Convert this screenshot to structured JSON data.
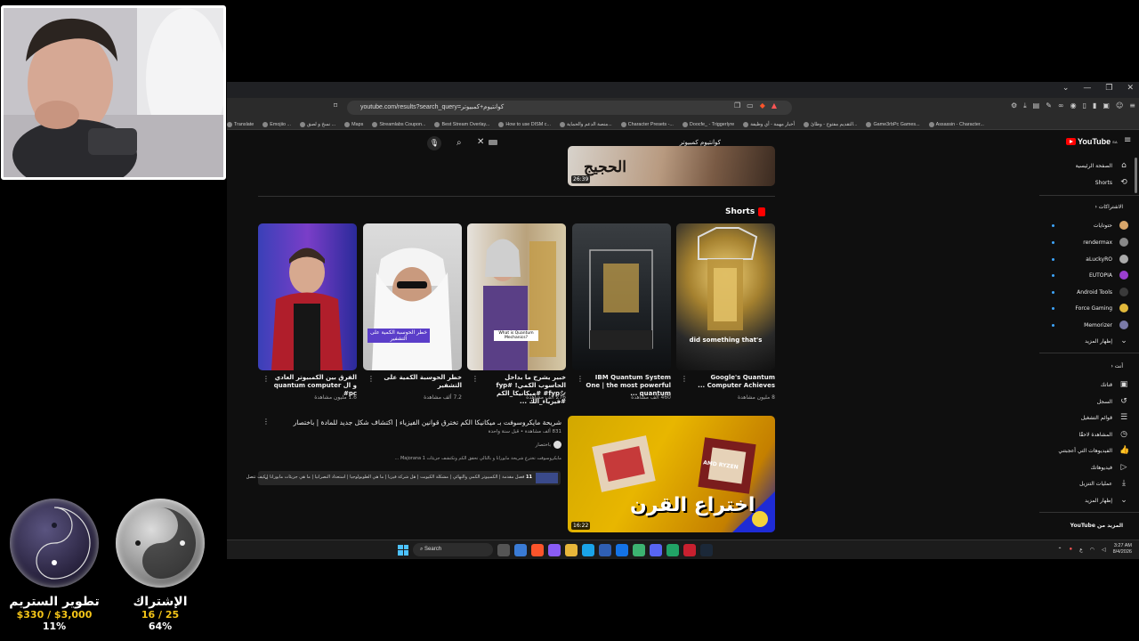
{
  "browser": {
    "url": "youtube.com/results?search_query=كوانتيوم+كمبيوتر",
    "bookmarks": [
      "Translate",
      "Emojiio ...",
      "نسخ و لصق ...",
      "Maps",
      "Streamlabs Coupon...",
      "Best Stream Overlay...",
      "How to use DISM c...",
      "منصة الدعم والحماية...",
      "Character Presets -...",
      "Doocfe_ - Triggerlyre",
      "أخبار مهمة - أي وظيفة",
      "التقديم مفتوح - وظائ...",
      "Game3rbPc Games...",
      "Assassin - Character..."
    ]
  },
  "search": {
    "query": "كوانتيوم كمبيوتر"
  },
  "top_video": {
    "title_art": "الحجيج",
    "duration": "26:39"
  },
  "shorts": {
    "heading": "Shorts",
    "items": [
      {
        "title": "Google's Quantum Computer Achieves ...",
        "views": "8 مليون مشاهدة",
        "caption": "did something that's"
      },
      {
        "title": "IBM Quantum System One | the most powerful quantum ...",
        "views": "460 ألف مشاهدة",
        "caption": ""
      },
      {
        "title": "خبير يشرح ما بداخل الحاسوب الكمي! #fyp #fypシ #ميكانيكا_الكم #فيزياء_الك ...",
        "views": "276 ألف مشاهدة",
        "caption": "What is Quantum Mechanics?"
      },
      {
        "title": "خطر الحوسبة الكمية على التشفير",
        "views": "7.2 ألف مشاهدة",
        "caption": "خطر الحوسبة الكمية على التشفير"
      },
      {
        "title": "الفرق بين الكمبيوتر العادي و ال quantum computer #pc",
        "views": "1.6 مليون مشاهدة",
        "caption": ""
      }
    ]
  },
  "video2": {
    "title": "شريحة مايكروسوفت بـ ميكانيكا الكم تخترق قوانين الفيزياء | اكتشاف شكل جديد للمادة | باختصار",
    "meta": "831 ألف مشاهدة • قبل سنة واحدة",
    "channel": "باختصار",
    "desc": "مايكروسوفت تخترع شريحة مايورانا و بالتالي تحقق الكم وتكتشف جزيئات Majorana 1 ...",
    "chapters_count": "11",
    "chapters_text": "فصل مقدمة | الكمبيوتر الكمي والنهائي | مشكلة الكيوبت | هل شركة فيزيا | ما هي الطوبولوجيا | استعداد النصرانيا | ما هي جزيئات مايورانا | كيف تتصل",
    "thumb_text": "اختراع القرن",
    "duration": "16:22",
    "chip_brand": "AMD RYZEN"
  },
  "sidebar": {
    "logo": "YouTube",
    "logo_region": "SA",
    "home": "الصفحة الرئيسية",
    "shorts": "Shorts",
    "subs_header": "الاشتراكات",
    "subs": [
      {
        "name": "حتوتايات",
        "color": "#d9a66a"
      },
      {
        "name": "rendermax",
        "color": "#888888"
      },
      {
        "name": "aLuckyRO",
        "color": "#aaaaaa"
      },
      {
        "name": "EUTOPIA",
        "color": "#9b3fd1"
      },
      {
        "name": "Android Tools",
        "color": "#3a3a3a"
      },
      {
        "name": "Force Gaming",
        "color": "#e2b93b"
      },
      {
        "name": "Memorizer",
        "color": "#7a7aa8"
      }
    ],
    "show_more": "إظهار المزيد",
    "you_header": "أنت",
    "you_items": [
      "قناتك",
      "السجل",
      "قوائم التشغيل",
      "المشاهدة لاحقًا",
      "الفيديوهات التي أعجبتني",
      "فيديوهاتك",
      "عمليات التنزيل",
      "إظهار المزيد"
    ],
    "more_from": "المزيد من YouTube"
  },
  "taskbar": {
    "search": "Search",
    "time": "3:27 AM",
    "date": "8/4/2026"
  },
  "goals": [
    {
      "label": "تطوير الستريم",
      "progress": "$330 / $3,000",
      "percent": "11%"
    },
    {
      "label": "الإشتراك",
      "progress": "16 / 25",
      "percent": "64%"
    }
  ]
}
